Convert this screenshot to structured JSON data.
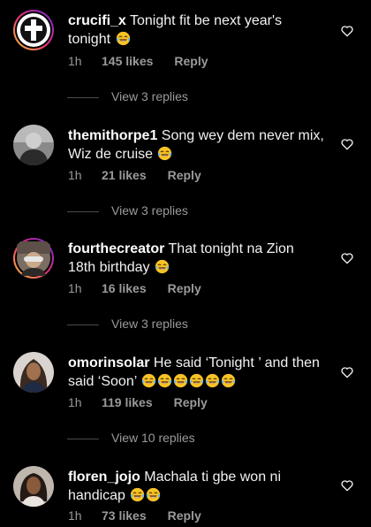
{
  "colors": {
    "background": "#000000",
    "text": "#f2f2f2",
    "muted": "#9a9a9a",
    "ring_gradient": [
      "#f9ce34",
      "#ee2a7b",
      "#6228d7"
    ]
  },
  "comments": [
    {
      "username": "crucifi_x",
      "text": "Tonight fit be next year's tonight",
      "emojis": [
        "tears-of-joy"
      ],
      "time": "1h",
      "likes": "145 likes",
      "reply": "Reply",
      "view_replies": "View 3 replies",
      "avatar": "cross-logo-avatar"
    },
    {
      "username": "themithorpe1",
      "text": "Song wey dem never mix, Wiz de cruise",
      "emojis": [
        "tears-of-joy"
      ],
      "time": "1h",
      "likes": "21 likes",
      "reply": "Reply",
      "view_replies": "View 3 replies",
      "avatar": "person-photo-avatar"
    },
    {
      "username": "fourthecreator",
      "text": "That tonight na Zion 18th birthday",
      "emojis": [
        "tears-of-joy"
      ],
      "time": "1h",
      "likes": "16 likes",
      "reply": "Reply",
      "view_replies": "View 3 replies",
      "avatar": "person-photo-avatar"
    },
    {
      "username": "omorinsolar",
      "text": "He said ‘Tonight ’ and then said ‘Soon’",
      "emojis": [
        "tears-of-joy",
        "tears-of-joy",
        "tears-of-joy",
        "tears-of-joy",
        "tears-of-joy",
        "tears-of-joy"
      ],
      "time": "1h",
      "likes": "119 likes",
      "reply": "Reply",
      "view_replies": "View 10 replies",
      "avatar": "person-photo-avatar"
    },
    {
      "username": "floren_jojo",
      "text": "Machala ti gbe won ni handicap",
      "emojis": [
        "tears-of-joy",
        "tears-of-joy"
      ],
      "time": "1h",
      "likes": "73 likes",
      "reply": "Reply",
      "avatar": "person-photo-avatar"
    }
  ]
}
